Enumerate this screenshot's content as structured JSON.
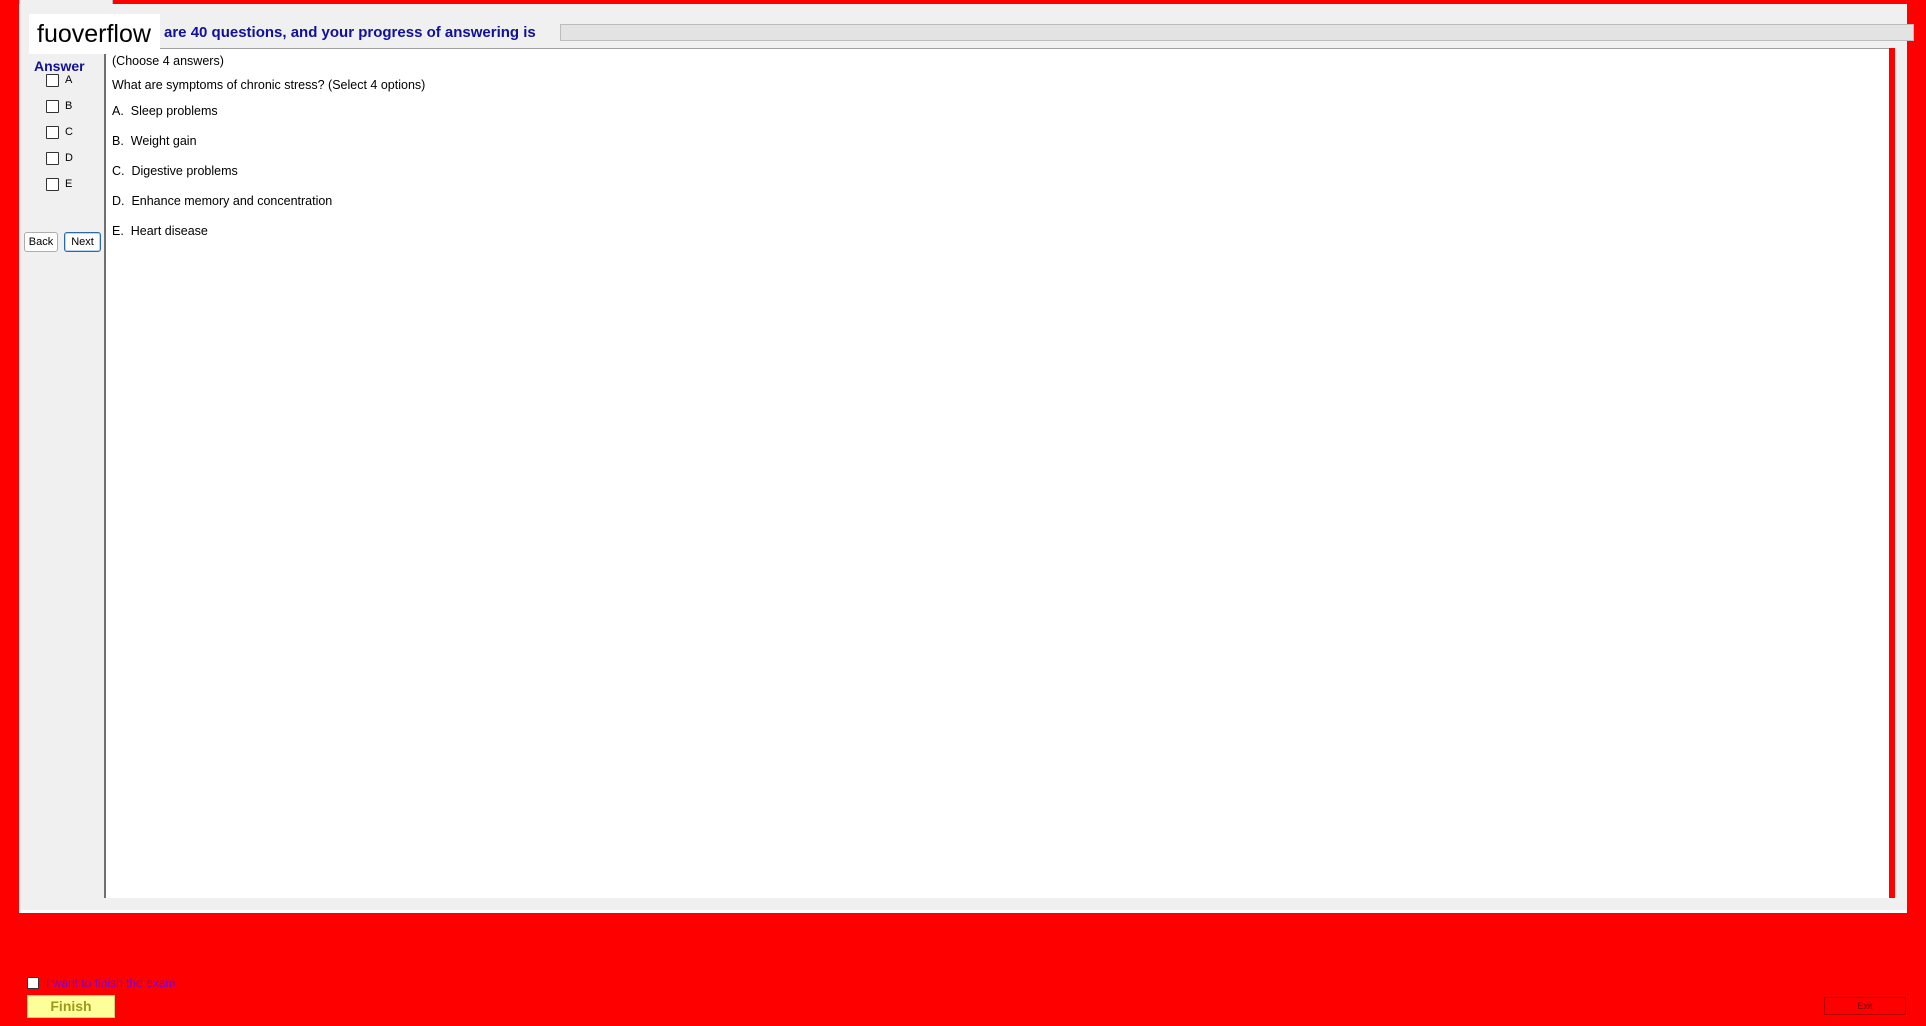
{
  "header": {
    "logo_text": "fuoverflow",
    "progress_text": "are 40 questions, and your progress of answering is",
    "progress_fraction": 0
  },
  "answer_panel": {
    "title": "Answer",
    "options": [
      "A",
      "B",
      "C",
      "D",
      "E"
    ],
    "back_label": "Back",
    "next_label": "Next"
  },
  "question": {
    "instruction": "(Choose 4 answers)",
    "text": "What are symptoms of chronic stress? (Select 4 options)",
    "choices": [
      "A.  Sleep problems",
      "B.  Weight gain",
      "C.  Digestive problems",
      "D.  Enhance memory and concentration",
      "E.  Heart disease"
    ]
  },
  "footer": {
    "finish_check_label": "I want to finish the exam",
    "finish_label": "Finish",
    "exit_label": "Exit"
  },
  "colors": {
    "background": "#fe0000",
    "panel": "#f0f0f0",
    "label_blue": "#10109a",
    "finish_yellow": "#ffff99"
  }
}
